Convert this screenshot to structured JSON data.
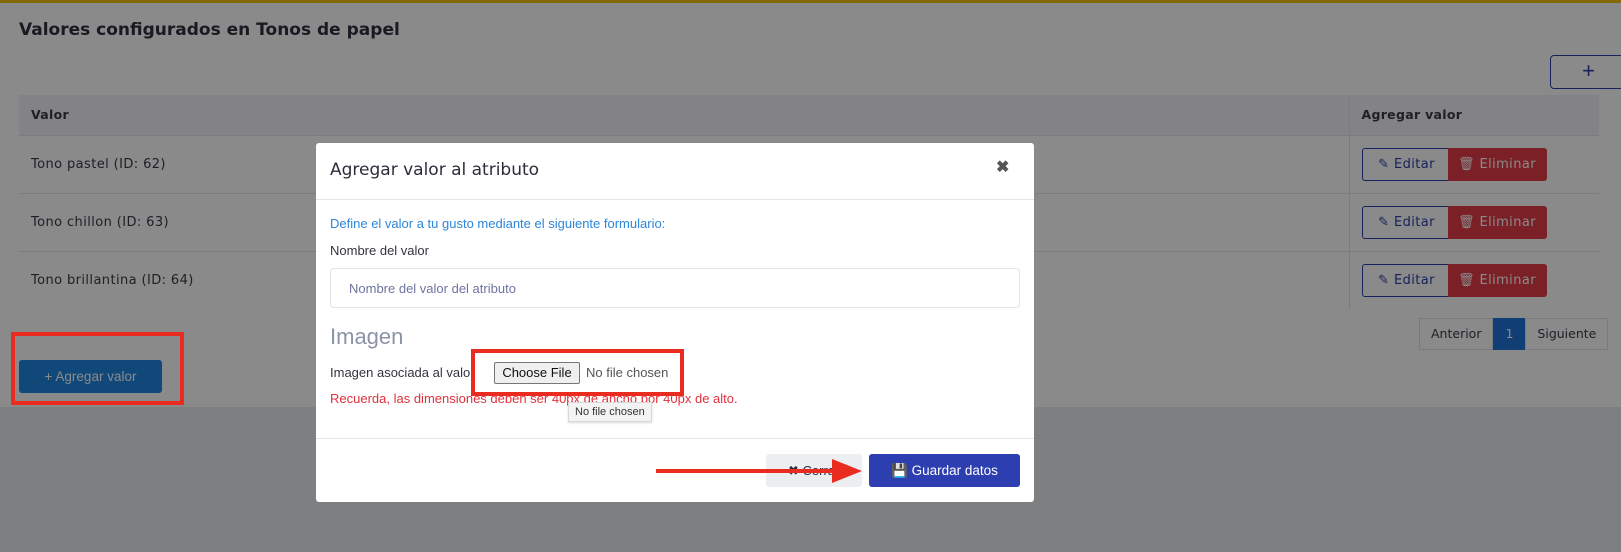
{
  "card": {
    "title": "Valores configurados en Tonos de papel",
    "add_icon": "+"
  },
  "table": {
    "headers": [
      "Valor",
      "Agregar valor"
    ],
    "rows": [
      {
        "value": "Tono pastel (ID: 62)",
        "edit": "Editar",
        "delete": "Eliminar"
      },
      {
        "value": "Tono chillon (ID: 63)",
        "edit": "Editar",
        "delete": "Eliminar"
      },
      {
        "value": "Tono brillantina (ID: 64)",
        "edit": "Editar",
        "delete": "Eliminar"
      }
    ]
  },
  "pagination": {
    "prev": "Anterior",
    "current": "1",
    "next": "Siguiente"
  },
  "add_value_button": "+ Agregar valor",
  "modal": {
    "title": "Agregar valor al atributo",
    "close_icon": "✖",
    "info": "Define el valor a tu gusto mediante el siguiente formulario:",
    "name_label": "Nombre del valor",
    "name_placeholder": "Nombre del valor del atributo",
    "image_section": "Imagen",
    "image_label": "Imagen asociada al valor",
    "choose_file": "Choose File",
    "no_file": "No file chosen",
    "warning": "Recuerda, las dimensiones deben ser 40px de ancho por 40px de alto.",
    "tooltip": "No file chosen",
    "close_button": "✖ Cerrar",
    "save_button": "Guardar datos"
  },
  "colors": {
    "accent": "#2c3eb0",
    "danger": "#e23b46",
    "highlight": "#ea2b1f",
    "info": "#2b86d9"
  }
}
